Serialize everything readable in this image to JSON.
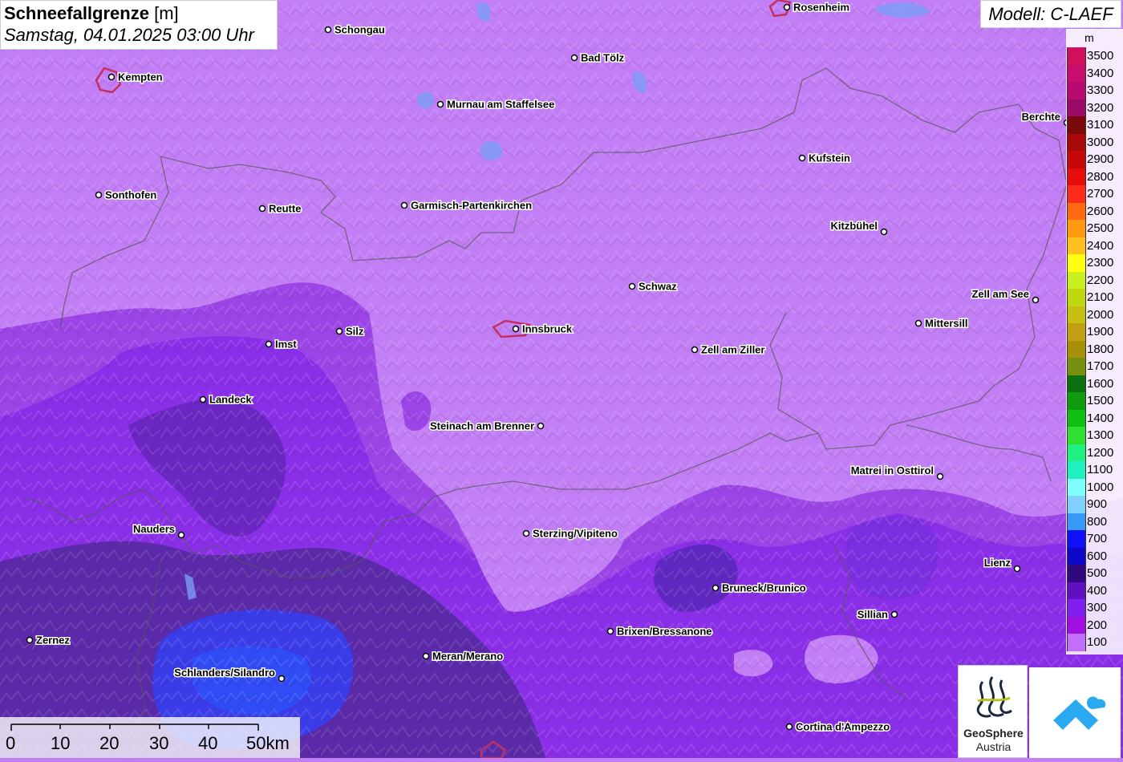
{
  "title": {
    "main": "Schneefallgrenze",
    "unit": "[m]",
    "datetime": "Samstag, 04.01.2025 03:00 Uhr"
  },
  "model": "Modell: C-LAEF",
  "legend": {
    "unit": "m",
    "steps": [
      {
        "label": "3500",
        "color": "#d0105a"
      },
      {
        "label": "3400",
        "color": "#c80d6e"
      },
      {
        "label": "3300",
        "color": "#b80a70"
      },
      {
        "label": "3200",
        "color": "#9a0a68"
      },
      {
        "label": "3100",
        "color": "#7a0a0a"
      },
      {
        "label": "3000",
        "color": "#a80808"
      },
      {
        "label": "2900",
        "color": "#c80808"
      },
      {
        "label": "2800",
        "color": "#e80c0c"
      },
      {
        "label": "2700",
        "color": "#ff2a1a"
      },
      {
        "label": "2600",
        "color": "#ff6a10"
      },
      {
        "label": "2500",
        "color": "#ff9a10"
      },
      {
        "label": "2400",
        "color": "#ffc020"
      },
      {
        "label": "2300",
        "color": "#ffff10"
      },
      {
        "label": "2200",
        "color": "#c8f020"
      },
      {
        "label": "2100",
        "color": "#c0d810"
      },
      {
        "label": "2000",
        "color": "#c8c010"
      },
      {
        "label": "1900",
        "color": "#c0a010"
      },
      {
        "label": "1800",
        "color": "#a89008"
      },
      {
        "label": "1700",
        "color": "#789010"
      },
      {
        "label": "1600",
        "color": "#0a7010"
      },
      {
        "label": "1500",
        "color": "#109a10"
      },
      {
        "label": "1400",
        "color": "#10c010"
      },
      {
        "label": "1300",
        "color": "#30e030"
      },
      {
        "label": "1200",
        "color": "#20f080"
      },
      {
        "label": "1100",
        "color": "#20f0c0"
      },
      {
        "label": "1000",
        "color": "#80ffff"
      },
      {
        "label": "900",
        "color": "#80d0ff"
      },
      {
        "label": "800",
        "color": "#3898f8"
      },
      {
        "label": "700",
        "color": "#1010f8"
      },
      {
        "label": "600",
        "color": "#1008c8"
      },
      {
        "label": "500",
        "color": "#300880"
      },
      {
        "label": "400",
        "color": "#6010c0"
      },
      {
        "label": "300",
        "color": "#8020f0"
      },
      {
        "label": "200",
        "color": "#a010e0"
      },
      {
        "label": "100",
        "color": "#c070f8"
      }
    ]
  },
  "cities": [
    {
      "name": "Rosenheim"
    },
    {
      "name": "Schongau"
    },
    {
      "name": "Kempten"
    },
    {
      "name": "Bad Tölz"
    },
    {
      "name": "Murnau am Staffelsee"
    },
    {
      "name": "Berchte"
    },
    {
      "name": "Kufstein"
    },
    {
      "name": "Sonthofen"
    },
    {
      "name": "Reutte"
    },
    {
      "name": "Garmisch-Partenkirchen"
    },
    {
      "name": "Kitzbühel"
    },
    {
      "name": "Schwaz"
    },
    {
      "name": "Zell am See"
    },
    {
      "name": "Silz"
    },
    {
      "name": "Innsbruck"
    },
    {
      "name": "Mittersill"
    },
    {
      "name": "Imst"
    },
    {
      "name": "Zell am Ziller"
    },
    {
      "name": "Landeck"
    },
    {
      "name": "Steinach am Brenner"
    },
    {
      "name": "Matrei in Osttirol"
    },
    {
      "name": "Nauders"
    },
    {
      "name": "Sterzing/Vipiteno"
    },
    {
      "name": "Lienz"
    },
    {
      "name": "Bruneck/Brunico"
    },
    {
      "name": "Sillian"
    },
    {
      "name": "Brixen/Bressanone"
    },
    {
      "name": "Zernez"
    },
    {
      "name": "Meran/Merano"
    },
    {
      "name": "Schlanders/Silandro"
    },
    {
      "name": "Cortina d'Ampezzo"
    }
  ],
  "scale_bar": {
    "labels": [
      "0",
      "10",
      "20",
      "30",
      "40",
      "50km"
    ]
  },
  "logos": {
    "geosphere_name": "GeoSphere",
    "geosphere_sub": "Austria"
  }
}
